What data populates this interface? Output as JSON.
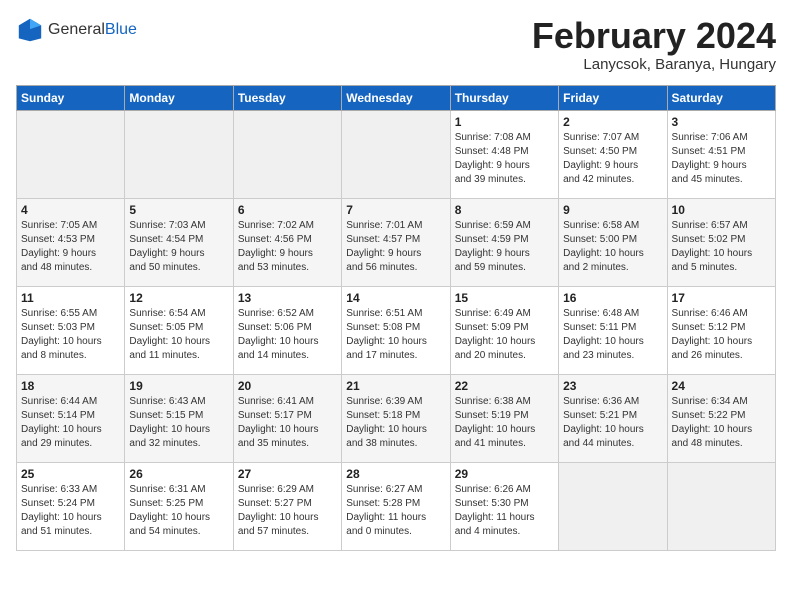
{
  "header": {
    "logo_general": "General",
    "logo_blue": "Blue",
    "month_year": "February 2024",
    "location": "Lanycsok, Baranya, Hungary"
  },
  "days_of_week": [
    "Sunday",
    "Monday",
    "Tuesday",
    "Wednesday",
    "Thursday",
    "Friday",
    "Saturday"
  ],
  "weeks": [
    [
      {
        "day": "",
        "info": ""
      },
      {
        "day": "",
        "info": ""
      },
      {
        "day": "",
        "info": ""
      },
      {
        "day": "",
        "info": ""
      },
      {
        "day": "1",
        "info": "Sunrise: 7:08 AM\nSunset: 4:48 PM\nDaylight: 9 hours\nand 39 minutes."
      },
      {
        "day": "2",
        "info": "Sunrise: 7:07 AM\nSunset: 4:50 PM\nDaylight: 9 hours\nand 42 minutes."
      },
      {
        "day": "3",
        "info": "Sunrise: 7:06 AM\nSunset: 4:51 PM\nDaylight: 9 hours\nand 45 minutes."
      }
    ],
    [
      {
        "day": "4",
        "info": "Sunrise: 7:05 AM\nSunset: 4:53 PM\nDaylight: 9 hours\nand 48 minutes."
      },
      {
        "day": "5",
        "info": "Sunrise: 7:03 AM\nSunset: 4:54 PM\nDaylight: 9 hours\nand 50 minutes."
      },
      {
        "day": "6",
        "info": "Sunrise: 7:02 AM\nSunset: 4:56 PM\nDaylight: 9 hours\nand 53 minutes."
      },
      {
        "day": "7",
        "info": "Sunrise: 7:01 AM\nSunset: 4:57 PM\nDaylight: 9 hours\nand 56 minutes."
      },
      {
        "day": "8",
        "info": "Sunrise: 6:59 AM\nSunset: 4:59 PM\nDaylight: 9 hours\nand 59 minutes."
      },
      {
        "day": "9",
        "info": "Sunrise: 6:58 AM\nSunset: 5:00 PM\nDaylight: 10 hours\nand 2 minutes."
      },
      {
        "day": "10",
        "info": "Sunrise: 6:57 AM\nSunset: 5:02 PM\nDaylight: 10 hours\nand 5 minutes."
      }
    ],
    [
      {
        "day": "11",
        "info": "Sunrise: 6:55 AM\nSunset: 5:03 PM\nDaylight: 10 hours\nand 8 minutes."
      },
      {
        "day": "12",
        "info": "Sunrise: 6:54 AM\nSunset: 5:05 PM\nDaylight: 10 hours\nand 11 minutes."
      },
      {
        "day": "13",
        "info": "Sunrise: 6:52 AM\nSunset: 5:06 PM\nDaylight: 10 hours\nand 14 minutes."
      },
      {
        "day": "14",
        "info": "Sunrise: 6:51 AM\nSunset: 5:08 PM\nDaylight: 10 hours\nand 17 minutes."
      },
      {
        "day": "15",
        "info": "Sunrise: 6:49 AM\nSunset: 5:09 PM\nDaylight: 10 hours\nand 20 minutes."
      },
      {
        "day": "16",
        "info": "Sunrise: 6:48 AM\nSunset: 5:11 PM\nDaylight: 10 hours\nand 23 minutes."
      },
      {
        "day": "17",
        "info": "Sunrise: 6:46 AM\nSunset: 5:12 PM\nDaylight: 10 hours\nand 26 minutes."
      }
    ],
    [
      {
        "day": "18",
        "info": "Sunrise: 6:44 AM\nSunset: 5:14 PM\nDaylight: 10 hours\nand 29 minutes."
      },
      {
        "day": "19",
        "info": "Sunrise: 6:43 AM\nSunset: 5:15 PM\nDaylight: 10 hours\nand 32 minutes."
      },
      {
        "day": "20",
        "info": "Sunrise: 6:41 AM\nSunset: 5:17 PM\nDaylight: 10 hours\nand 35 minutes."
      },
      {
        "day": "21",
        "info": "Sunrise: 6:39 AM\nSunset: 5:18 PM\nDaylight: 10 hours\nand 38 minutes."
      },
      {
        "day": "22",
        "info": "Sunrise: 6:38 AM\nSunset: 5:19 PM\nDaylight: 10 hours\nand 41 minutes."
      },
      {
        "day": "23",
        "info": "Sunrise: 6:36 AM\nSunset: 5:21 PM\nDaylight: 10 hours\nand 44 minutes."
      },
      {
        "day": "24",
        "info": "Sunrise: 6:34 AM\nSunset: 5:22 PM\nDaylight: 10 hours\nand 48 minutes."
      }
    ],
    [
      {
        "day": "25",
        "info": "Sunrise: 6:33 AM\nSunset: 5:24 PM\nDaylight: 10 hours\nand 51 minutes."
      },
      {
        "day": "26",
        "info": "Sunrise: 6:31 AM\nSunset: 5:25 PM\nDaylight: 10 hours\nand 54 minutes."
      },
      {
        "day": "27",
        "info": "Sunrise: 6:29 AM\nSunset: 5:27 PM\nDaylight: 10 hours\nand 57 minutes."
      },
      {
        "day": "28",
        "info": "Sunrise: 6:27 AM\nSunset: 5:28 PM\nDaylight: 11 hours\nand 0 minutes."
      },
      {
        "day": "29",
        "info": "Sunrise: 6:26 AM\nSunset: 5:30 PM\nDaylight: 11 hours\nand 4 minutes."
      },
      {
        "day": "",
        "info": ""
      },
      {
        "day": "",
        "info": ""
      }
    ]
  ]
}
